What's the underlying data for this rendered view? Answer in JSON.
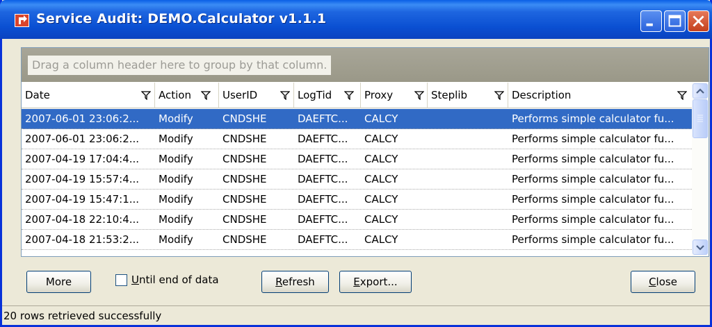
{
  "window": {
    "title": "Service Audit: DEMO.Calculator v1.1.1",
    "app_icon": "app-icon",
    "controls": [
      "minimize-icon",
      "maximize-icon",
      "close-icon"
    ]
  },
  "grid": {
    "group_hint": "Drag a column header here to group by that column.",
    "columns": [
      "Date",
      "Action",
      "UserID",
      "LogTid",
      "Proxy",
      "Steplib",
      "Description"
    ],
    "rows": [
      [
        "2007-06-01  23:06:2...",
        "Modify",
        "CNDSHE",
        "DAEFTC...",
        "CALCY",
        "",
        "Performs  simple  calculator  fu..."
      ],
      [
        "2007-06-01  23:06:2...",
        "Modify",
        "CNDSHE",
        "DAEFTC...",
        "CALCY",
        "",
        "Performs  simple  calculator  fu..."
      ],
      [
        "2007-04-19  17:04:4...",
        "Modify",
        "CNDSHE",
        "DAEFTC...",
        "CALCY",
        "",
        "Performs  simple  calculator  fu..."
      ],
      [
        "2007-04-19  15:57:4...",
        "Modify",
        "CNDSHE",
        "DAEFTC...",
        "CALCY",
        "",
        "Performs  simple  calculator  fu..."
      ],
      [
        "2007-04-19  15:47:1...",
        "Modify",
        "CNDSHE",
        "DAEFTC...",
        "CALCY",
        "",
        "Performs  simple  calculator  fu..."
      ],
      [
        "2007-04-18  22:10:4...",
        "Modify",
        "CNDSHE",
        "DAEFTC...",
        "CALCY",
        "",
        "Performs  simple  calculator  fu..."
      ],
      [
        "2007-04-18  21:53:2...",
        "Modify",
        "CNDSHE",
        "DAEFTC...",
        "CALCY",
        "",
        "Performs  simple  calculator  fu..."
      ]
    ],
    "selected_row": 0
  },
  "buttons": {
    "more": "More",
    "until_end_first": "U",
    "until_end_rest": "ntil end of data",
    "refresh_first": "R",
    "refresh_rest": "efresh",
    "export_first": "E",
    "export_rest": "xport...",
    "close_first": "C",
    "close_rest": "lose"
  },
  "status": {
    "text": "20 rows retrieved successfully"
  },
  "colors": {
    "title_bar": "#0a4fd2",
    "selection": "#316ac5",
    "window_bg": "#ece9d8"
  }
}
